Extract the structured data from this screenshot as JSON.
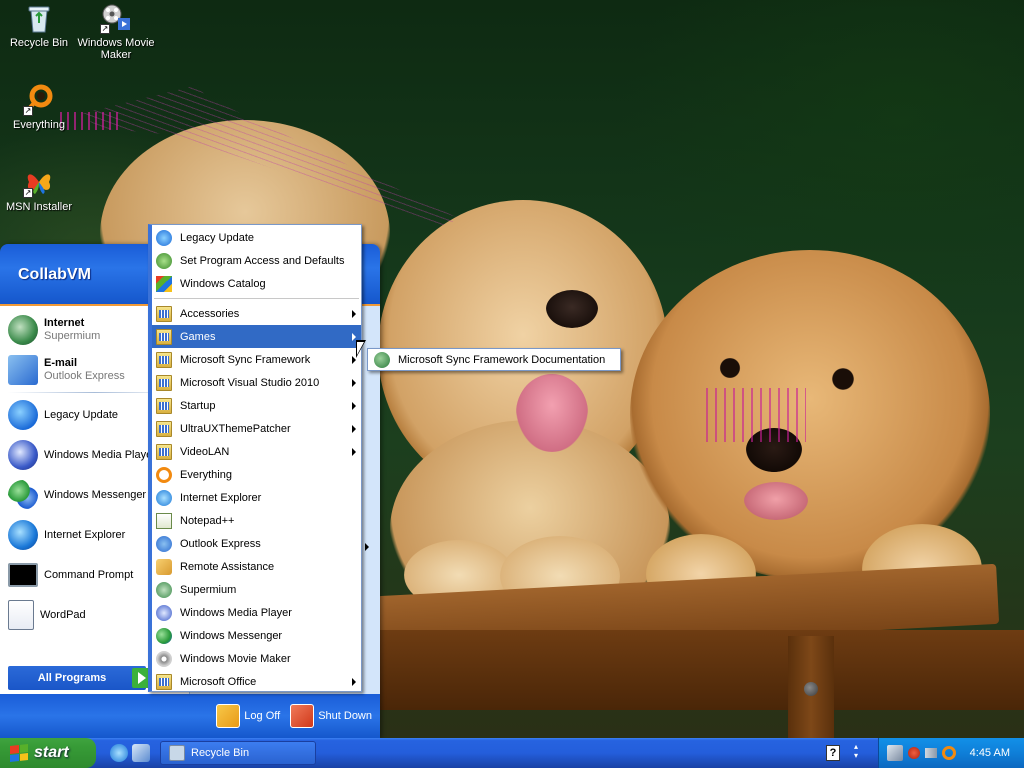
{
  "desktop": {
    "icons": [
      {
        "label": "Recycle Bin"
      },
      {
        "label": "Windows Movie Maker"
      },
      {
        "label": "Everything"
      },
      {
        "label": "MSN Installer"
      }
    ]
  },
  "start_menu": {
    "user": "CollabVM",
    "pinned": [
      {
        "title": "Internet",
        "subtitle": "Supermium"
      },
      {
        "title": "E-mail",
        "subtitle": "Outlook Express"
      }
    ],
    "recent": [
      {
        "label": "Legacy Update"
      },
      {
        "label": "Windows Media Player"
      },
      {
        "label": "Windows Messenger"
      },
      {
        "label": "Internet Explorer"
      },
      {
        "label": "Command Prompt"
      },
      {
        "label": "WordPad"
      }
    ],
    "all_programs_label": "All Programs",
    "log_off_label": "Log Off",
    "shut_down_label": "Shut Down"
  },
  "all_programs": {
    "top_items": [
      {
        "label": "Legacy Update"
      },
      {
        "label": "Set Program Access and Defaults"
      },
      {
        "label": "Windows Catalog"
      }
    ],
    "items": [
      {
        "label": "Accessories"
      },
      {
        "label": "Games"
      },
      {
        "label": "Microsoft Sync Framework"
      },
      {
        "label": "Microsoft Visual Studio 2010"
      },
      {
        "label": "Startup"
      },
      {
        "label": "UltraUXThemePatcher"
      },
      {
        "label": "VideoLAN"
      },
      {
        "label": "Everything"
      },
      {
        "label": "Internet Explorer"
      },
      {
        "label": "Notepad++"
      },
      {
        "label": "Outlook Express"
      },
      {
        "label": "Remote Assistance"
      },
      {
        "label": "Supermium"
      },
      {
        "label": "Windows Media Player"
      },
      {
        "label": "Windows Messenger"
      },
      {
        "label": "Windows Movie Maker"
      },
      {
        "label": "Microsoft Office"
      }
    ],
    "selected": "Games"
  },
  "submenu": {
    "items": [
      {
        "label": "Microsoft Sync Framework Documentation"
      }
    ]
  },
  "taskbar": {
    "start_label": "start",
    "window_button": "Recycle Bin",
    "clock": "4:45 AM",
    "help_glyph": "?"
  },
  "colors": {
    "xp_blue": "#245edb",
    "start_green": "#3fa33f",
    "selection": "#316ac5",
    "tray_blue": "#0f7fd8"
  }
}
